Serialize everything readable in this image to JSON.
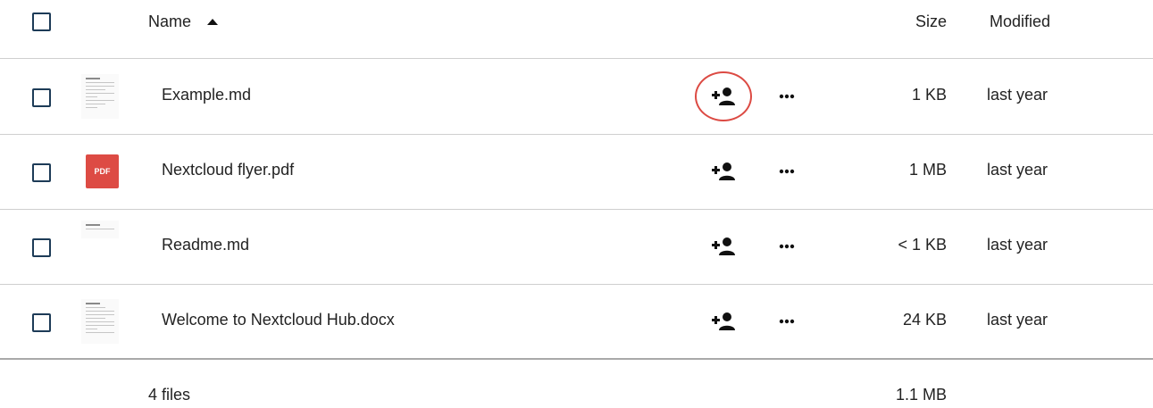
{
  "header": {
    "name_label": "Name",
    "size_label": "Size",
    "modified_label": "Modified",
    "sort_icon": "sort-ascending-icon"
  },
  "files": [
    {
      "name": "Example.md",
      "size": "1 KB",
      "modified": "last year",
      "thumbnail": "document-thumbnail"
    },
    {
      "name": "Nextcloud flyer.pdf",
      "size": "1 MB",
      "modified": "last year",
      "thumbnail": "pdf-icon",
      "thumb_text": "PDF"
    },
    {
      "name": "Readme.md",
      "size": "< 1 KB",
      "modified": "last year",
      "thumbnail": "document-thumbnail"
    },
    {
      "name": "Welcome to Nextcloud Hub.docx",
      "size": "24 KB",
      "modified": "last year",
      "thumbnail": "document-thumbnail"
    }
  ],
  "actions": {
    "share_icon": "share-add-user-icon",
    "more_icon": "more-dots-icon"
  },
  "footer": {
    "count": "4 files",
    "total_size": "1.1 MB"
  },
  "colors": {
    "checkbox_border": "#1d3b57",
    "highlight_ring": "#dc4a43",
    "pdf_red": "#dd4b44"
  }
}
